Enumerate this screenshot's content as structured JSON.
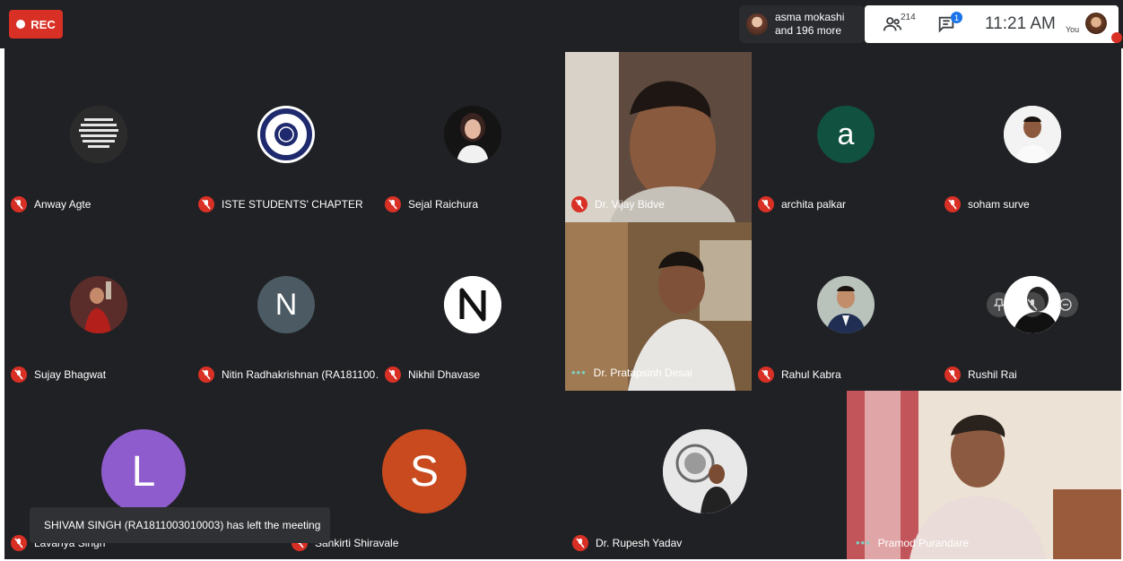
{
  "toolbar": {
    "rec_label": "REC",
    "presence": {
      "line1": "asma mokashi",
      "line2": "and 196 more"
    },
    "people_count": "214",
    "chat_badge": "1",
    "clock": "11:21 AM",
    "you_label": "You"
  },
  "participants": [
    {
      "name": "Anway Agte"
    },
    {
      "name": "ISTE STUDENTS' CHAPTER"
    },
    {
      "name": "Sejal Raichura"
    },
    {
      "name": "Dr. Vijay Bidve"
    },
    {
      "name": "archita palkar",
      "initial": "a"
    },
    {
      "name": "soham surve"
    },
    {
      "name": "Sujay Bhagwat"
    },
    {
      "name": "Nitin Radhakrishnan (RA181100…",
      "initial": "N"
    },
    {
      "name": "Nikhil Dhavase"
    },
    {
      "name": "Dr. Pratapsinh Desai"
    },
    {
      "name": "Rahul Kabra"
    },
    {
      "name": "Rushil Rai"
    },
    {
      "name": "Lavanya Singh",
      "initial": "L"
    },
    {
      "name": "Sankirti Shiravale",
      "initial": "S"
    },
    {
      "name": "Dr. Rupesh Yadav"
    },
    {
      "name": "Pramod Purandare"
    }
  ],
  "toast": "SHIVAM SINGH (RA1811003010003) has left the meeting",
  "colors": {
    "background": "#202124",
    "rec": "#d93025",
    "muted_mic": "#d93025",
    "archita_avatar": "#10523f",
    "nitin_avatar": "#4b5a63",
    "lavanya_avatar": "#8e5ccc",
    "sankirti_avatar": "#c94a1f",
    "speaking": "#7fd0c1"
  }
}
